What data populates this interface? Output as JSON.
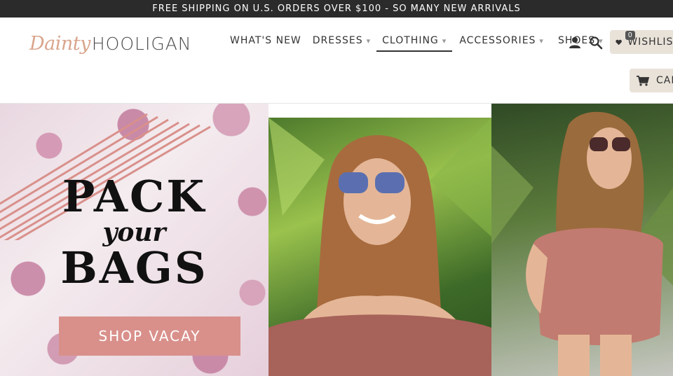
{
  "announcement": "FREE SHIPPING ON U.S. ORDERS OVER $100 - SO MANY NEW ARRIVALS",
  "logo": {
    "script": "Dainty",
    "word": "HOOLIGAN"
  },
  "nav": {
    "items": [
      {
        "label": "WHAT'S NEW",
        "caret": ""
      },
      {
        "label": "DRESSES",
        "caret": "▾"
      },
      {
        "label": "CLOTHING",
        "caret": "▾"
      },
      {
        "label": "ACCESSORIES",
        "caret": "▾"
      },
      {
        "label": "SHOES",
        "caret": "▾"
      }
    ],
    "active_index": 2
  },
  "icons": {
    "user": "user-icon",
    "search": "search-icon",
    "heart": "heart-icon",
    "cart": "cart-icon"
  },
  "wishlist": {
    "count": "0",
    "label": "WISHLIST"
  },
  "cart": {
    "label": "CART"
  },
  "hero": {
    "line1": "PACK",
    "line2": "your",
    "line3": "BAGS",
    "button": "SHOP VACAY"
  },
  "colors": {
    "accent": "#d9908b",
    "announce_bg": "#2b2b2b",
    "tag_bg": "#e9e2d9",
    "logo_script": "#d9a58c"
  }
}
